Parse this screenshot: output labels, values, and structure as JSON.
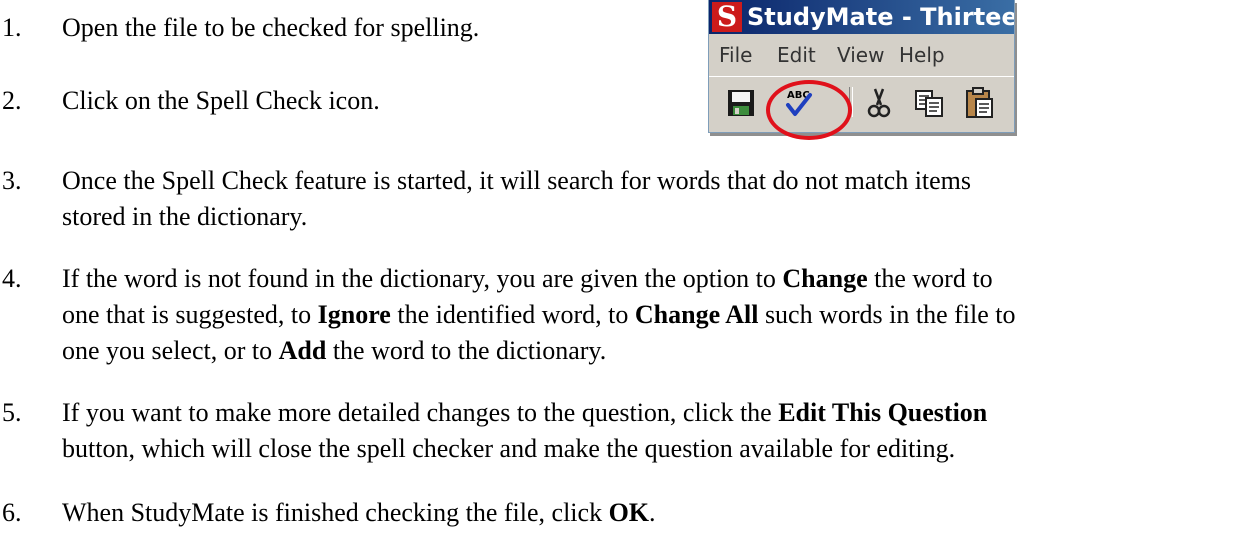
{
  "steps": [
    {
      "num": "1.",
      "parts": [
        {
          "text": "Open the file to be checked for spelling.",
          "bold": false
        }
      ]
    },
    {
      "num": "2.",
      "parts": [
        {
          "text": "Click on the Spell Check icon.",
          "bold": false
        }
      ]
    },
    {
      "num": "3.",
      "lines": [
        "Once the Spell Check feature is started, it will search for words that do not match items",
        "stored in the dictionary."
      ]
    },
    {
      "num": "4.",
      "segments": [
        "If the word is not found in the dictionary, you are given the option to ",
        "Change",
        " the word to",
        "one that is suggested, to ",
        "Ignore",
        " the identified word, to ",
        "Change All",
        " such words in the file to",
        "one you select, or to ",
        "Add",
        " the word to the dictionary."
      ]
    },
    {
      "num": "5.",
      "segments": [
        "If you want to make more detailed changes to the question, click the ",
        "Edit This Question",
        "button, which will close the spell checker and make the question available for editing."
      ]
    },
    {
      "num": "6.",
      "segments": [
        "When StudyMate is finished checking the file, click ",
        "OK",
        "."
      ]
    }
  ],
  "window": {
    "logo": "S",
    "title": "StudyMate - Thirteen C",
    "menu": [
      "File",
      "Edit",
      "View",
      "Help"
    ],
    "toolbar_icons": [
      "save-icon",
      "spell-check-icon",
      "cut-icon",
      "copy-icon",
      "paste-icon"
    ],
    "spell_check_label": "ABC"
  },
  "colors": {
    "title_bar": "#0a246a",
    "window_face": "#d4d0c8",
    "highlight": "#e0111b",
    "logo": "#cc1b1b"
  }
}
